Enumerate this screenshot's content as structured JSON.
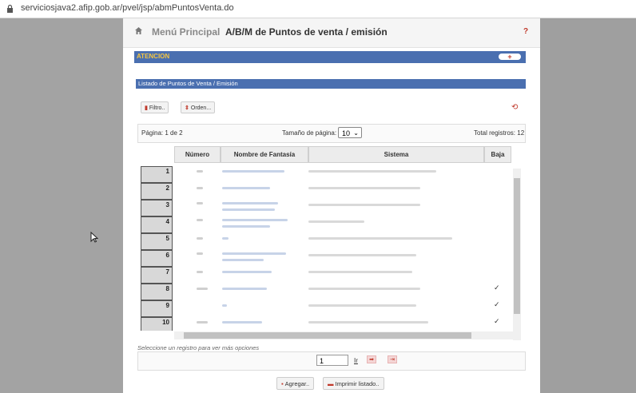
{
  "browser": {
    "url": "serviciosjava2.afip.gob.ar/pvel/jsp/abmPuntosVenta.do"
  },
  "header": {
    "menu_link": "Menú Principal",
    "separator": "›",
    "title": "A/B/M de Puntos de venta / emisión",
    "help": "?"
  },
  "atencion": {
    "label": "ATENCION",
    "toggle": "+"
  },
  "list": {
    "title": "Listado de Puntos de Venta / Emisión"
  },
  "toolbar": {
    "filter_label": "Filtro..",
    "order_label": "Orden...",
    "refresh": "⟲"
  },
  "pager": {
    "page_text": "Página: 1 de 2",
    "page_size_label": "Tamaño de página:",
    "page_size_value": "10",
    "total_text": "Total registros: 12"
  },
  "table": {
    "columns": [
      "Número",
      "Nombre de Fantasía",
      "Sistema",
      "Baja"
    ],
    "row_numbers": [
      "1",
      "2",
      "3",
      "4",
      "5",
      "6",
      "7",
      "8",
      "9",
      "10"
    ],
    "checkmarks": [
      "✓",
      "✓",
      "✓"
    ]
  },
  "footer": {
    "hint": "Seleccione un registro para ver más opciones",
    "page_input": "1",
    "go_link": "Ir",
    "next": "➡",
    "last": "⇥",
    "add_label": "Agregar..",
    "print_label": "Imprimir listado.."
  }
}
